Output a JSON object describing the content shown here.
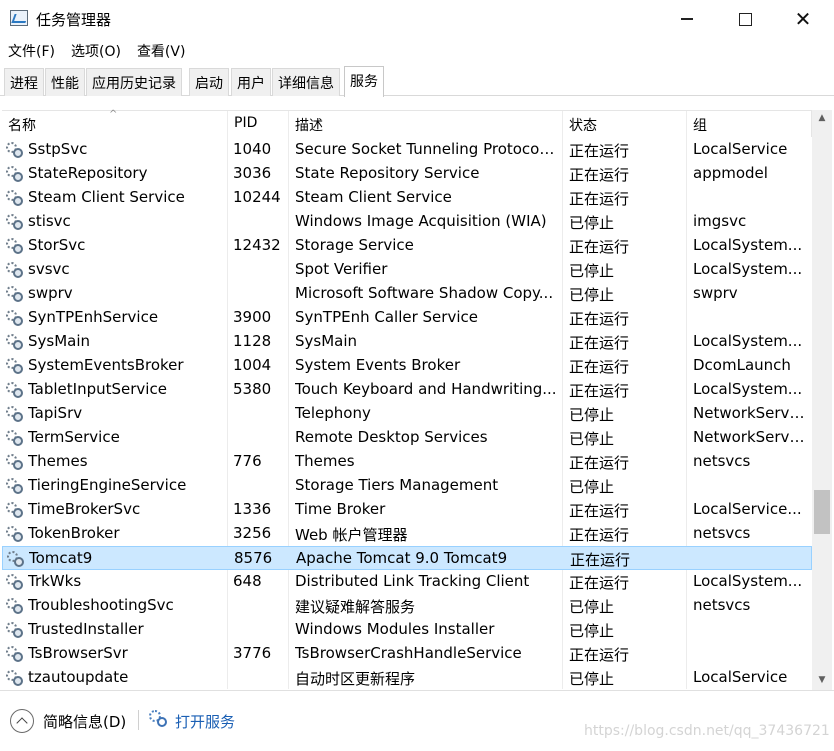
{
  "window": {
    "title": "任务管理器",
    "close_glyph": "✕"
  },
  "menu": [
    "文件(F)",
    "选项(O)",
    "查看(V)"
  ],
  "tabs": [
    {
      "label": "进程",
      "active": false
    },
    {
      "label": "性能",
      "active": false
    },
    {
      "label": "应用历史记录",
      "active": false
    },
    {
      "label": "启动",
      "active": false
    },
    {
      "label": "用户",
      "active": false
    },
    {
      "label": "详细信息",
      "active": false
    },
    {
      "label": "服务",
      "active": true
    }
  ],
  "table": {
    "columns": [
      "名称",
      "PID",
      "描述",
      "状态",
      "组"
    ],
    "sort_indicator": "^",
    "rows": [
      {
        "name": "SstpSvc",
        "pid": "1040",
        "desc": "Secure Socket Tunneling Protocol...",
        "status": "正在运行",
        "group": "LocalService"
      },
      {
        "name": "StateRepository",
        "pid": "3036",
        "desc": "State Repository Service",
        "status": "正在运行",
        "group": "appmodel"
      },
      {
        "name": "Steam Client Service",
        "pid": "10244",
        "desc": "Steam Client Service",
        "status": "正在运行",
        "group": ""
      },
      {
        "name": "stisvc",
        "pid": "",
        "desc": "Windows Image Acquisition (WIA)",
        "status": "已停止",
        "group": "imgsvc"
      },
      {
        "name": "StorSvc",
        "pid": "12432",
        "desc": "Storage Service",
        "status": "正在运行",
        "group": "LocalSystem..."
      },
      {
        "name": "svsvc",
        "pid": "",
        "desc": "Spot Verifier",
        "status": "已停止",
        "group": "LocalSystem..."
      },
      {
        "name": "swprv",
        "pid": "",
        "desc": "Microsoft Software Shadow Copy...",
        "status": "已停止",
        "group": "swprv"
      },
      {
        "name": "SynTPEnhService",
        "pid": "3900",
        "desc": "SynTPEnh Caller Service",
        "status": "正在运行",
        "group": ""
      },
      {
        "name": "SysMain",
        "pid": "1128",
        "desc": "SysMain",
        "status": "正在运行",
        "group": "LocalSystem..."
      },
      {
        "name": "SystemEventsBroker",
        "pid": "1004",
        "desc": "System Events Broker",
        "status": "正在运行",
        "group": "DcomLaunch"
      },
      {
        "name": "TabletInputService",
        "pid": "5380",
        "desc": "Touch Keyboard and Handwriting...",
        "status": "正在运行",
        "group": "LocalSystem..."
      },
      {
        "name": "TapiSrv",
        "pid": "",
        "desc": "Telephony",
        "status": "已停止",
        "group": "NetworkServi..."
      },
      {
        "name": "TermService",
        "pid": "",
        "desc": "Remote Desktop Services",
        "status": "已停止",
        "group": "NetworkServi..."
      },
      {
        "name": "Themes",
        "pid": "776",
        "desc": "Themes",
        "status": "正在运行",
        "group": "netsvcs"
      },
      {
        "name": "TieringEngineService",
        "pid": "",
        "desc": "Storage Tiers Management",
        "status": "已停止",
        "group": ""
      },
      {
        "name": "TimeBrokerSvc",
        "pid": "1336",
        "desc": "Time Broker",
        "status": "正在运行",
        "group": "LocalService..."
      },
      {
        "name": "TokenBroker",
        "pid": "3256",
        "desc": "Web 帐户管理器",
        "status": "正在运行",
        "group": "netsvcs"
      },
      {
        "name": "Tomcat9",
        "pid": "8576",
        "desc": "Apache Tomcat 9.0 Tomcat9",
        "status": "正在运行",
        "group": "",
        "selected": true
      },
      {
        "name": "TrkWks",
        "pid": "648",
        "desc": "Distributed Link Tracking Client",
        "status": "正在运行",
        "group": "LocalSystem..."
      },
      {
        "name": "TroubleshootingSvc",
        "pid": "",
        "desc": "建议疑难解答服务",
        "status": "已停止",
        "group": "netsvcs"
      },
      {
        "name": "TrustedInstaller",
        "pid": "",
        "desc": "Windows Modules Installer",
        "status": "已停止",
        "group": ""
      },
      {
        "name": "TsBrowserSvr",
        "pid": "3776",
        "desc": "TsBrowserCrashHandleService",
        "status": "正在运行",
        "group": ""
      },
      {
        "name": "tzautoupdate",
        "pid": "",
        "desc": "自动时区更新程序",
        "status": "已停止",
        "group": "LocalService"
      }
    ]
  },
  "footer": {
    "brief_label": "简略信息(D)",
    "open_services_label": "打开服务",
    "watermark": "https://blog.csdn.net/qq_37436721"
  },
  "colors": {
    "selected_row": "#cce8ff",
    "link": "#1a5fb4"
  }
}
